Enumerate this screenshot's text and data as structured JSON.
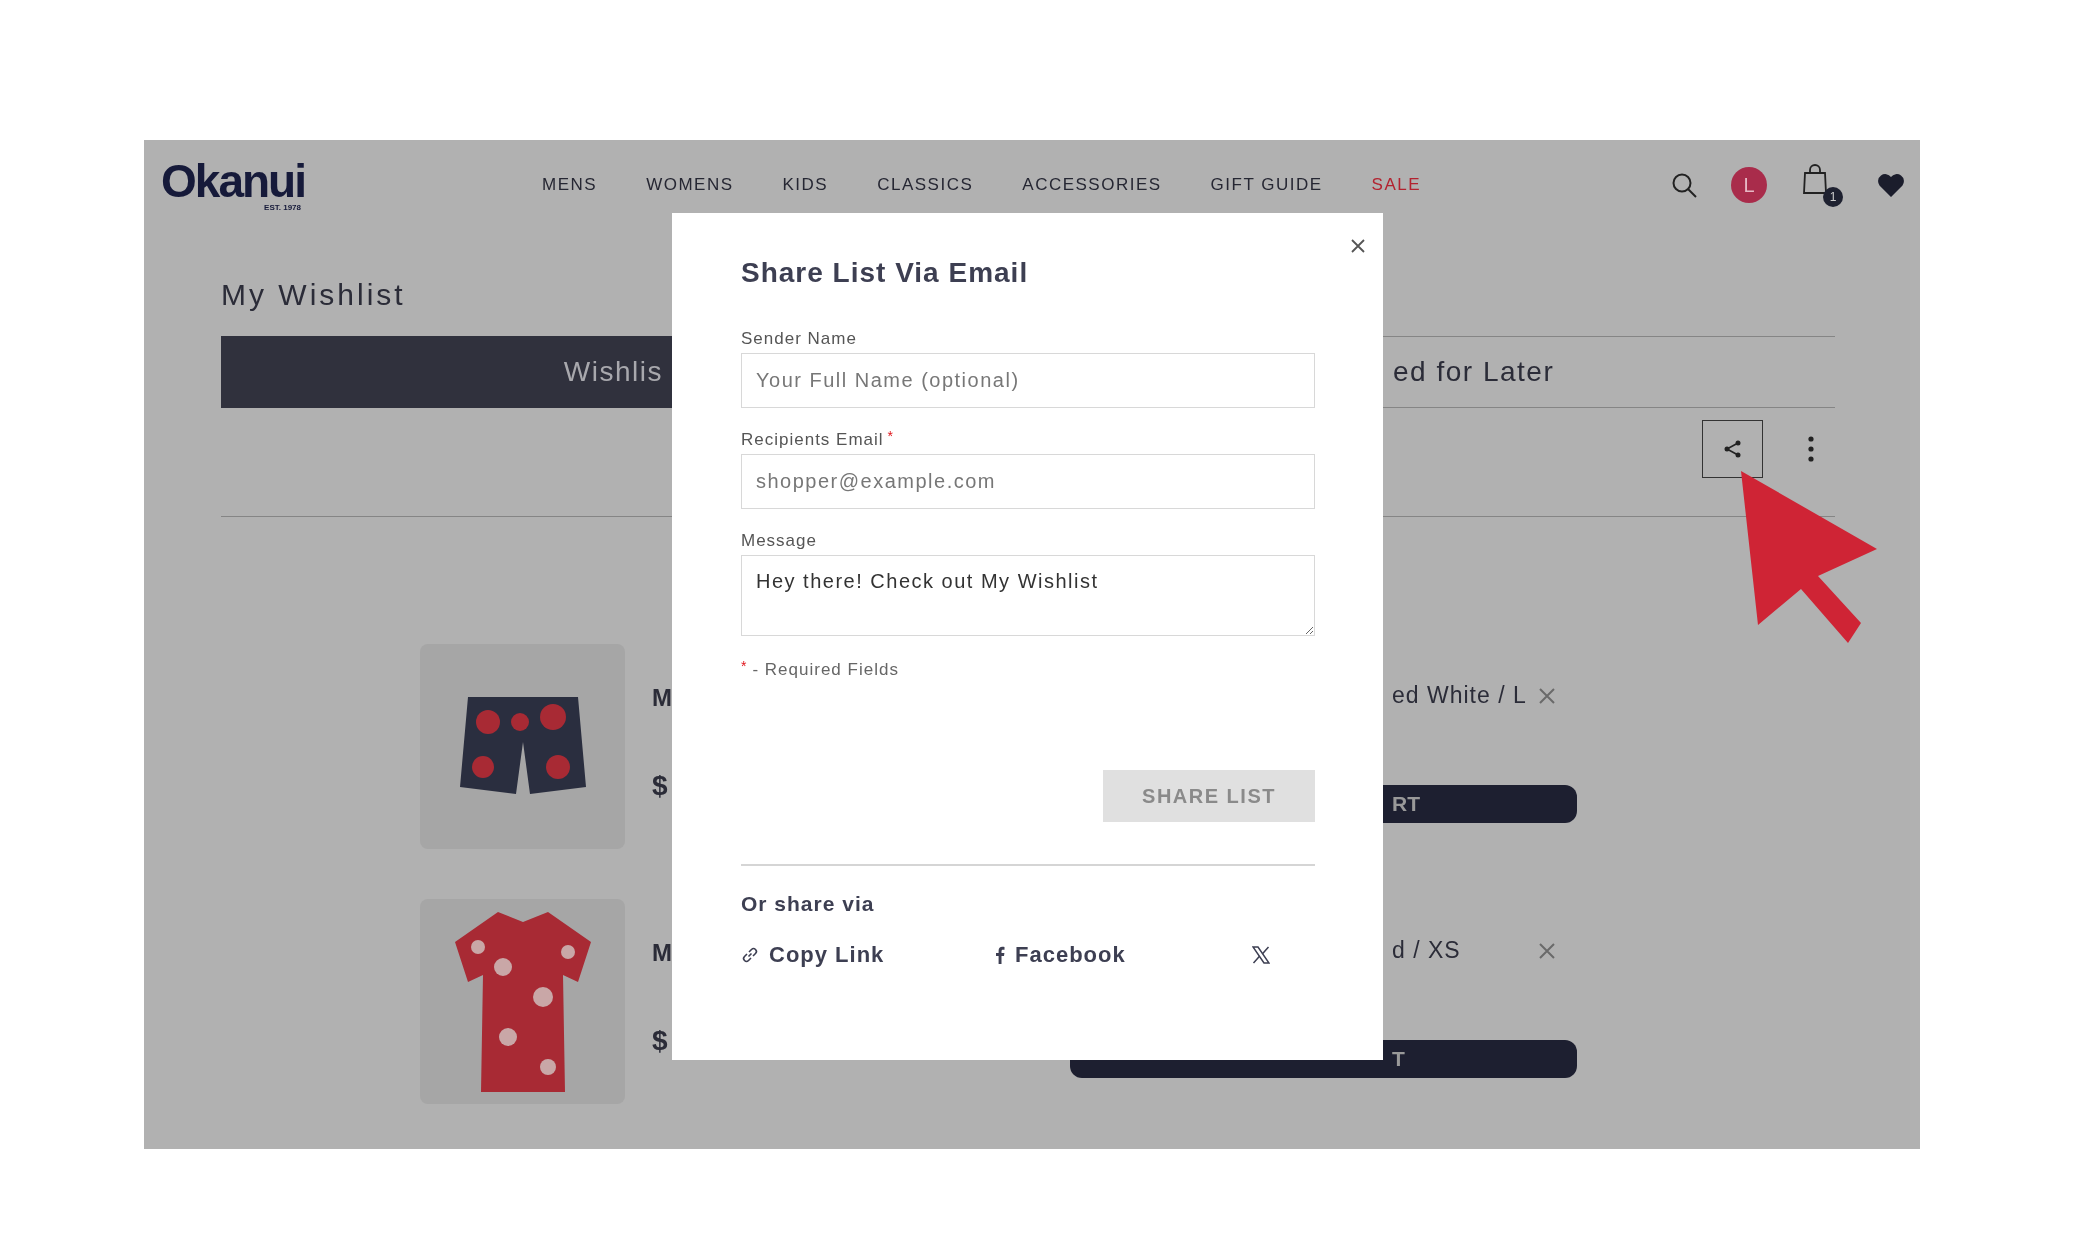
{
  "header": {
    "logo": "Okanui",
    "logo_tagline": "EST. 1978",
    "nav": [
      {
        "label": "MENS",
        "kind": "normal"
      },
      {
        "label": "WOMENS",
        "kind": "normal"
      },
      {
        "label": "KIDS",
        "kind": "normal"
      },
      {
        "label": "CLASSICS",
        "kind": "normal"
      },
      {
        "label": "ACCESSORIES",
        "kind": "normal"
      },
      {
        "label": "GIFT GUIDE",
        "kind": "normal"
      },
      {
        "label": "SALE",
        "kind": "sale"
      }
    ],
    "avatar_initial": "L",
    "cart_count": "1"
  },
  "page_title": "My Wishlist",
  "tabs": [
    {
      "label": "Wishlis",
      "selected": true
    },
    {
      "label": "ed for Later",
      "selected": false
    }
  ],
  "products": [
    {
      "title": "M",
      "price": "$",
      "variant": "ed White / L",
      "cart_button": "RT",
      "kind": "shorts"
    },
    {
      "title": "M",
      "price": "$",
      "variant": "d / XS",
      "cart_button": "T",
      "kind": "shirt"
    }
  ],
  "modal": {
    "title": "Share List Via Email",
    "fields": [
      {
        "label": "Sender Name",
        "kind": "input",
        "placeholder": "Your Full Name (optional)"
      },
      {
        "label": "Recipients Email",
        "kind": "input",
        "required_mark": "*",
        "placeholder": "shopper@example.com"
      },
      {
        "label": "Message",
        "kind": "textarea",
        "value": "Hey there! Check out My Wishlist"
      }
    ],
    "required_note": {
      "mark": "*",
      "text": "- Required Fields"
    },
    "submit": {
      "label": "SHARE LIST",
      "disabled": true
    },
    "share_via_title": "Or share via",
    "share_links": [
      {
        "label": "Copy Link",
        "kind": "link"
      },
      {
        "label": "Facebook",
        "kind": "facebook"
      },
      {
        "kind": "x"
      }
    ]
  }
}
